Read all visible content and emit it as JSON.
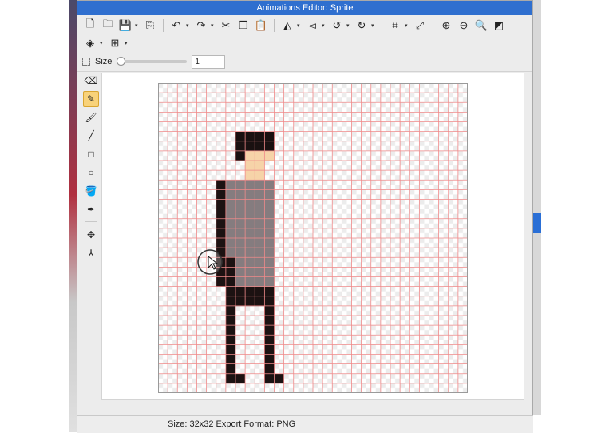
{
  "window": {
    "title": "Animations Editor: Sprite"
  },
  "toolbar": {
    "row1": [
      {
        "name": "new-file-icon",
        "glyph": "🗋"
      },
      {
        "name": "open-folder-icon",
        "glyph": "🗀"
      },
      {
        "name": "save-icon",
        "glyph": "💾"
      },
      {
        "name": "dropdown-arrow",
        "glyph": "▾"
      },
      {
        "name": "export-icon",
        "glyph": "⎘"
      },
      {
        "name": "undo-icon",
        "glyph": "↶"
      },
      {
        "name": "dropdown-arrow",
        "glyph": "▾"
      },
      {
        "name": "redo-icon",
        "glyph": "↷"
      },
      {
        "name": "dropdown-arrow",
        "glyph": "▾"
      },
      {
        "name": "cut-icon",
        "glyph": "✂"
      },
      {
        "name": "copy-icon",
        "glyph": "❐"
      },
      {
        "name": "paste-icon",
        "glyph": "📋"
      },
      {
        "name": "flip-horizontal-icon",
        "glyph": "◭"
      },
      {
        "name": "dropdown-arrow",
        "glyph": "▾"
      },
      {
        "name": "flip-vertical-icon",
        "glyph": "◅"
      },
      {
        "name": "dropdown-arrow",
        "glyph": "▾"
      },
      {
        "name": "rotate-left-icon",
        "glyph": "↺"
      },
      {
        "name": "dropdown-arrow",
        "glyph": "▾"
      },
      {
        "name": "rotate-right-icon",
        "glyph": "↻"
      },
      {
        "name": "dropdown-arrow",
        "glyph": "▾"
      },
      {
        "name": "crop-icon",
        "glyph": "⌗"
      },
      {
        "name": "dropdown-arrow",
        "glyph": "▾"
      },
      {
        "name": "resize-icon",
        "glyph": "⤢"
      },
      {
        "name": "zoom-in-icon",
        "glyph": "⊕"
      },
      {
        "name": "zoom-out-icon",
        "glyph": "⊖"
      },
      {
        "name": "zoom-fit-icon",
        "glyph": "🔍"
      },
      {
        "name": "background-toggle-icon",
        "glyph": "◩"
      }
    ],
    "row2": [
      {
        "name": "layers-icon",
        "glyph": "◈"
      },
      {
        "name": "dropdown-arrow",
        "glyph": "▾"
      },
      {
        "name": "grid-icon",
        "glyph": "⊞"
      },
      {
        "name": "dropdown-arrow",
        "glyph": "▾"
      }
    ]
  },
  "options": {
    "size_label": "Size",
    "size_value": "1",
    "slider_fraction": 0.0
  },
  "tools": [
    {
      "name": "eraser-tool-icon",
      "glyph": "⌫",
      "active": false
    },
    {
      "name": "pencil-tool-icon",
      "glyph": "✎",
      "active": true
    },
    {
      "name": "brush-tool-icon",
      "glyph": "🖌",
      "active": false
    },
    {
      "name": "line-tool-icon",
      "glyph": "╱",
      "active": false
    },
    {
      "name": "rectangle-tool-icon",
      "glyph": "□",
      "active": false
    },
    {
      "name": "ellipse-tool-icon",
      "glyph": "○",
      "active": false
    },
    {
      "name": "fill-bucket-tool-icon",
      "glyph": "🪣",
      "active": false
    },
    {
      "name": "eyedropper-tool-icon",
      "glyph": "✒",
      "active": false
    },
    {
      "name": "separator"
    },
    {
      "name": "move-tool-icon",
      "glyph": "✥",
      "active": false
    },
    {
      "name": "skeleton-tool-icon",
      "glyph": "⅄",
      "active": false
    }
  ],
  "status": {
    "text": "Size: 32x32   Export Format: PNG"
  },
  "sprite": {
    "grid_size": 32,
    "colors": {
      "gridline": "#f08a8a",
      "hair": "#1a1111",
      "skin": "#f6d3a8",
      "shirt": "#857c7f",
      "dark": "#1c1212"
    },
    "rows": {
      "4": "................................",
      "5": "........HHHH....................",
      "6": "........HHHH....................",
      "7": "........HSSS....................",
      "8": ".........SS.....................",
      "9": ".........SS.....................",
      "10": "......DTTTTT....................",
      "11": "......DTTTTT....................",
      "12": "......DTTTTT....................",
      "13": "......DTTTTT....................",
      "14": "......DTTTTT....................",
      "15": "......DTTTTT....................",
      "16": "......DTTTTT....................",
      "17": "......DTTTTT....................",
      "18": "......DDTTTT....................",
      "19": "......DDTTTT....................",
      "20": "......DDTTTT....................",
      "21": ".......DDDDD....................",
      "22": ".......DDDDD....................",
      "23": ".......D...D....................",
      "24": ".......D...D....................",
      "25": ".......D...D....................",
      "26": ".......D...D....................",
      "27": ".......D...D....................",
      "28": ".......D...D....................",
      "29": ".......D...D....................",
      "30": ".......DD..DD..................."
    }
  }
}
